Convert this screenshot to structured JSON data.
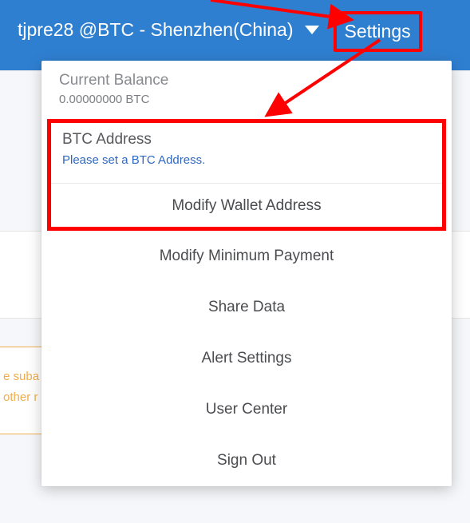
{
  "header": {
    "account_label": "tjpre28 @BTC - Shenzhen(China)",
    "settings_label": "Settings"
  },
  "dropdown": {
    "balance_label": "Current Balance",
    "balance_value": "0.00000000 BTC",
    "btc_address_label": "BTC Address",
    "btc_address_msg": "Please set a BTC Address.",
    "items": {
      "modify_wallet": "Modify Wallet Address",
      "modify_min_payment": "Modify Minimum Payment",
      "share_data": "Share Data",
      "alert_settings": "Alert Settings",
      "user_center": "User Center",
      "sign_out": "Sign Out"
    }
  },
  "bg": {
    "yellow_line1": "e suba",
    "yellow_line2": " other r"
  }
}
